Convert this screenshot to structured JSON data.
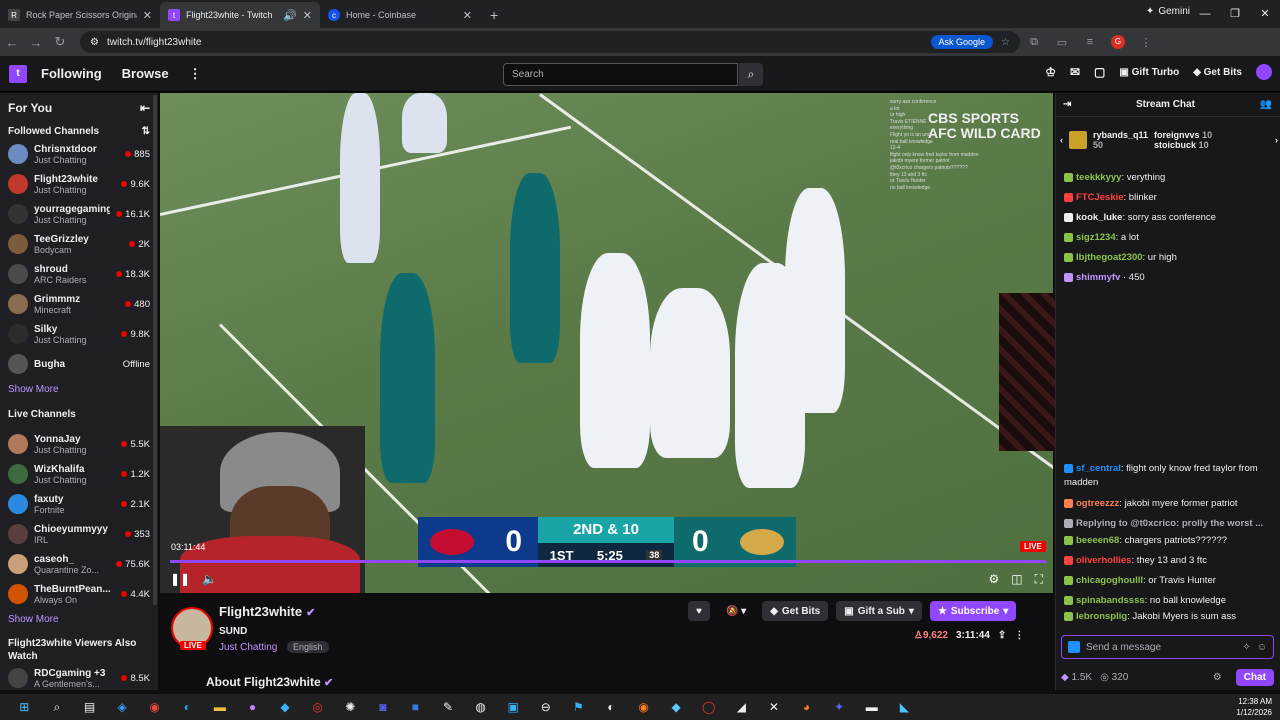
{
  "browser": {
    "tabs": [
      {
        "title": "Rock Paper Scissors Originals -",
        "active": false
      },
      {
        "title": "Flight23white - Twitch",
        "active": true
      },
      {
        "title": "Home - Coinbase",
        "active": false
      }
    ],
    "gemini_label": "Gemini",
    "url": "twitch.tv/flight23white",
    "ask_google": "Ask Google",
    "profile_initial": "G"
  },
  "nav": {
    "following": "Following",
    "browse": "Browse",
    "search_placeholder": "Search",
    "gift_turbo": "Gift Turbo",
    "get_bits": "Get Bits"
  },
  "sidebar": {
    "for_you": "For You",
    "followed_title": "Followed Channels",
    "followed": [
      {
        "name": "Chrisnxtdoor",
        "game": "Just Chatting",
        "viewers": "885",
        "color": "#6b8cbf"
      },
      {
        "name": "Flight23white",
        "game": "Just Chatting",
        "viewers": "9.6K",
        "color": "#c0392b"
      },
      {
        "name": "yourragegaming",
        "game": "Just Chatting",
        "viewers": "16.1K",
        "color": "#333333"
      },
      {
        "name": "TeeGrizzley",
        "game": "Bodycam",
        "viewers": "2K",
        "color": "#7a5b3a"
      },
      {
        "name": "shroud",
        "game": "ARC Raiders",
        "viewers": "18.3K",
        "color": "#4a4a4a"
      },
      {
        "name": "Grimmmz",
        "game": "Minecraft",
        "viewers": "480",
        "color": "#8a6d4f"
      },
      {
        "name": "Silky",
        "game": "Just Chatting",
        "viewers": "9.8K",
        "color": "#2c2c2c"
      },
      {
        "name": "Bugha",
        "game": "",
        "viewers": "Offline",
        "color": "#555555"
      }
    ],
    "show_more": "Show More",
    "live_title": "Live Channels",
    "live": [
      {
        "name": "YonnaJay",
        "game": "Just Chatting",
        "viewers": "5.5K",
        "color": "#b07a5a"
      },
      {
        "name": "WizKhalifa",
        "game": "Just Chatting",
        "viewers": "1.2K",
        "color": "#3d6b3d"
      },
      {
        "name": "faxuty",
        "game": "Fortnite",
        "viewers": "2.1K",
        "color": "#2b8ae0"
      },
      {
        "name": "Chioeyummyyy",
        "game": "IRL",
        "viewers": "353",
        "color": "#5a3d3d"
      },
      {
        "name": "caseoh_",
        "game": "Quarantine Zo...",
        "viewers": "75.6K",
        "color": "#c9a07a"
      },
      {
        "name": "TheBurntPean...",
        "game": "Always On",
        "viewers": "4.4K",
        "color": "#d35400"
      }
    ],
    "show_more_2": "Show More",
    "also_watch": "Flight23white Viewers Also Watch",
    "also": [
      {
        "name": "RDCgaming +3",
        "game": "A Gentlemen's...",
        "viewers": "8.5K",
        "color": "#444444"
      }
    ]
  },
  "video": {
    "cbs_line1": "CBS SPORTS",
    "cbs_line2": "AFC WILD CARD",
    "score_home": "0",
    "score_away": "0",
    "down_distance": "2ND & 10",
    "quarter": "1ST",
    "game_clock": "5:25",
    "play_clock": "38",
    "timecode": "03:11:44",
    "live": "LIVE",
    "overlay_chat": [
      "sorry ass conference",
      "a lot",
      "ur high",
      "Travis ETIENNE",
      "everything",
      "Flight yo is an unc",
      "real ball knowledge",
      "12-4",
      "flight only know fred taylor from madden",
      "jakobi myere former patriot",
      "@t0xcrico chargers patriots??????",
      "they 13 and 3 ftc",
      "or Travis Hunter",
      "no ball knowledge"
    ]
  },
  "channel": {
    "name": "Flight23white",
    "title": "SUND",
    "game": "Just Chatting",
    "language": "English",
    "live": "LIVE",
    "get_bits": "Get Bits",
    "gift_sub": "Gift a Sub",
    "subscribe": "Subscribe",
    "viewers": "9,622",
    "uptime": "3:11:44",
    "about": "About Flight23white"
  },
  "chat": {
    "title": "Stream Chat",
    "gifter1": "rybands_q11",
    "gifter1_count": "50",
    "gifter2": "foreignvvs",
    "gifter2_count": "10",
    "gifter3": "stoicbuck",
    "gifter3_count": "10",
    "messages": [
      {
        "user": "teekkkyyy",
        "text": ": verything",
        "color": "#8bc34a"
      },
      {
        "user": "FTCJeskie",
        "text": ": blinker",
        "color": "#ff4040"
      },
      {
        "user": "kook_luke",
        "text": ": sorry ass conference",
        "color": "#efeff1"
      },
      {
        "user": "sigz1234",
        "text": ": a lot",
        "color": "#8bc34a"
      },
      {
        "user": "lbjthegoat2300",
        "text": ": ur high",
        "color": "#8bc34a"
      },
      {
        "user": "shimmyfv",
        "text": " · 450",
        "color": "#bf94ff"
      }
    ],
    "messages2": [
      {
        "user": "sf_central",
        "text": ": flight only know fred taylor from madden",
        "color": "#1e90ff"
      },
      {
        "user": "ogtreezzz",
        "text": ": jakobi myere former patriot",
        "color": "#ff7f50"
      },
      {
        "user": "Replying to @t0xcrico: prolly the worst ...",
        "text": "",
        "color": "#adadb8"
      },
      {
        "user": "beeeen68",
        "text": ": chargers patriots??????",
        "color": "#8bc34a"
      },
      {
        "user": "oliverhollies",
        "text": ": they 13 and 3 ftc",
        "color": "#ff4040"
      },
      {
        "user": "chicagoghoulll",
        "text": ": or Travis Hunter",
        "color": "#8bc34a"
      },
      {
        "user": "spinabandssss",
        "text": ": no ball knowledge",
        "color": "#8bc34a"
      },
      {
        "user": "lebronsplig",
        "text": ": Jakobi Myers is sum ass",
        "color": "#8bc34a"
      }
    ],
    "placeholder": "Send a message",
    "bits": "1.5K",
    "points": "320",
    "chat_button": "Chat"
  },
  "taskbar": {
    "time": "12:38 AM",
    "date": "1/12/2026"
  }
}
